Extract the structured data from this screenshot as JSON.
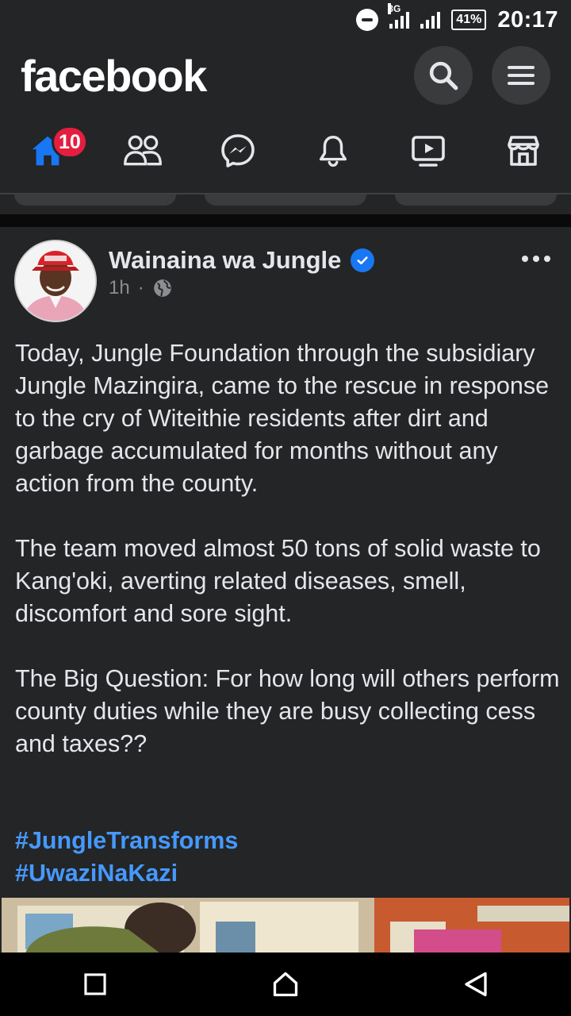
{
  "status_bar": {
    "network_type": "3G",
    "battery": "41%",
    "time": "20:17"
  },
  "header": {
    "brand": "facebook",
    "search_icon": "search-icon",
    "menu_icon": "menu-icon"
  },
  "tabs": [
    {
      "name": "home",
      "icon": "home-icon",
      "badge": "10",
      "active": true
    },
    {
      "name": "friends",
      "icon": "friends-icon"
    },
    {
      "name": "messenger",
      "icon": "messenger-icon"
    },
    {
      "name": "notifications",
      "icon": "bell-icon"
    },
    {
      "name": "watch",
      "icon": "video-icon"
    },
    {
      "name": "marketplace",
      "icon": "store-icon"
    }
  ],
  "post": {
    "author": "Wainaina wa Jungle",
    "time": "1h",
    "separator": "·",
    "paragraphs": [
      "Today, Jungle Foundation through the subsidiary Jungle Mazingira, came to the rescue in response to the cry of Witeithie residents after dirt and garbage accumulated for months without any action from the county.",
      "The team moved almost 50 tons of solid waste to Kang'oki, averting related diseases, smell, discomfort and sore sight.",
      "The Big Question: For how long will others perform county duties while they are busy collecting cess and taxes??"
    ],
    "hashtags": [
      "#JungleTransforms",
      "#UwaziNaKazi"
    ]
  },
  "colors": {
    "background": "#242526",
    "brand": "#ffffff",
    "accent_blue": "#1877f2",
    "hashtag": "#4599ff",
    "badge": "#e41e3f"
  }
}
